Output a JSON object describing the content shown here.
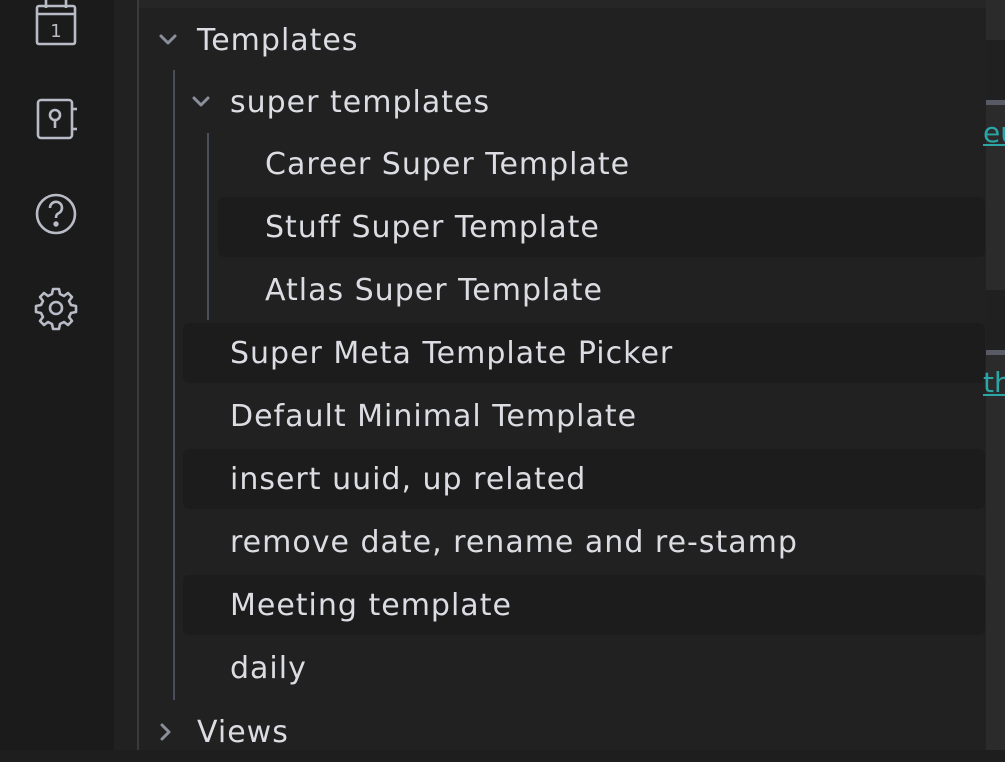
{
  "ribbon": {
    "icons": [
      "calendar-icon",
      "contact-card-icon",
      "help-icon",
      "settings-icon"
    ],
    "calendar_day": "1"
  },
  "tree": {
    "templates": {
      "label": "Templates",
      "expanded": true,
      "children": {
        "super_templates": {
          "label": "super templates",
          "expanded": true,
          "items": [
            "Career Super Template",
            "Stuff Super Template",
            "Atlas Super Template"
          ]
        },
        "files": [
          "Super Meta Template Picker",
          "Default Minimal Template",
          "insert uuid, up related",
          "remove date, rename and re-stamp",
          "Meeting template",
          "daily"
        ]
      }
    },
    "views": {
      "label": "Views",
      "expanded": false
    }
  },
  "editor": {
    "link_fragments": [
      "eu",
      "th"
    ]
  },
  "colors": {
    "ribbon_bg": "#1b1b1b",
    "panel_bg": "#212121",
    "text": "#dcdde3",
    "icon": "#b9bcc6",
    "link": "#2aa6a6"
  }
}
